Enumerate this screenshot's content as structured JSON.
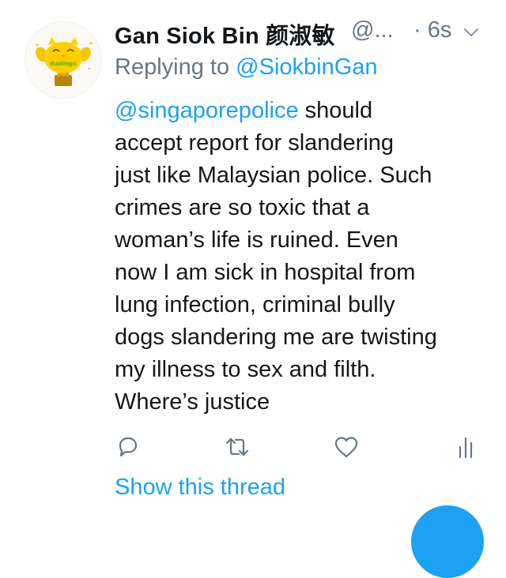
{
  "tweet": {
    "author_name": "Gan Siok Bin 颜淑敏",
    "author_handle": "@...",
    "timestamp": "· 6s",
    "reply_prefix": "Replying to",
    "reply_to": "@SiokbinGan",
    "mention": "@singaporepolice",
    "text_lines": [
      " should",
      "accept report for slandering",
      "just like Malaysian police. Such",
      "crimes are so toxic that a",
      "woman’s life is ruined. Even",
      "now I am sick in hospital from",
      "lung infection, criminal bully",
      "dogs slandering me are twisting",
      "my illness to sex and filth.",
      "Where’s justice"
    ],
    "show_thread_label": "Show this thread"
  },
  "avatar": {
    "logo_text": "duolingo"
  },
  "icons": {
    "caret": "chevron-down-icon",
    "reply": "reply-icon",
    "retweet": "retweet-icon",
    "like": "heart-icon",
    "analytics": "analytics-icon"
  },
  "colors": {
    "accent": "#1da1f2",
    "secondary_text": "#657786",
    "primary_text": "#14171a",
    "icon_gray": "#657786"
  }
}
